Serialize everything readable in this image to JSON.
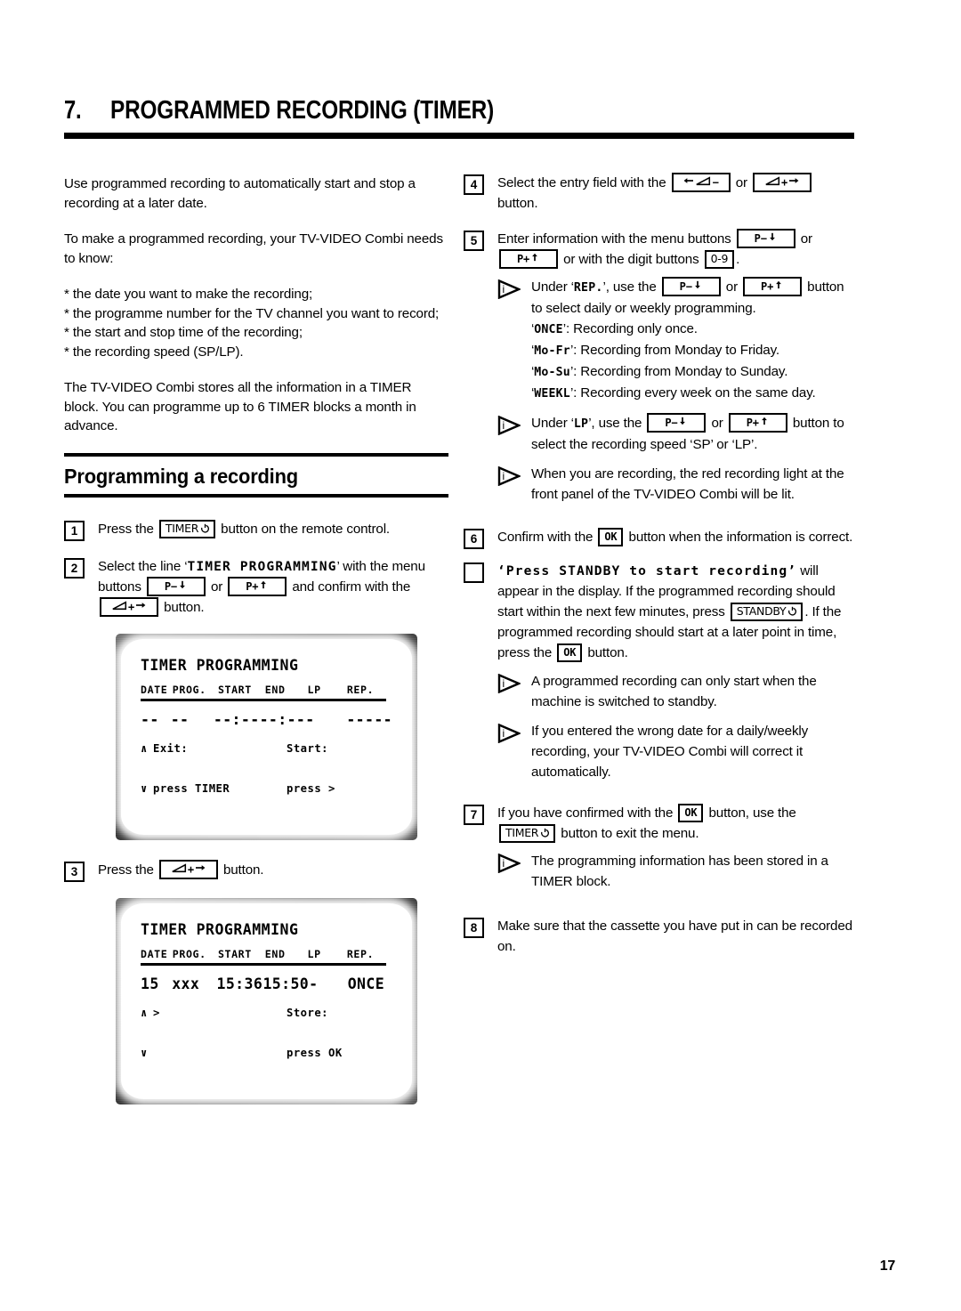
{
  "chapter": {
    "number": "7.",
    "title": "PROGRAMMED RECORDING (TIMER)"
  },
  "page_number": "17",
  "intro": {
    "para1": "Use programmed recording to automatically start and stop a recording at a later date.",
    "para2": "To make a programmed recording, your TV-VIDEO Combi needs to know:",
    "bullets": [
      "* the date you want to make the recording;",
      "* the programme number for the TV channel you want to record;",
      "* the start and stop time of the recording;",
      "* the recording speed (SP/LP)."
    ],
    "para3": "The TV-VIDEO Combi stores all the information in a TIMER block. You can programme up to 6 TIMER blocks a month in advance."
  },
  "section": {
    "heading": "Programming a recording"
  },
  "keys": {
    "timer": "TIMER",
    "standby": "STANDBY",
    "ok": "OK",
    "digits": "0-9",
    "p_minus": "P",
    "p_plus": "P",
    "minus": "−",
    "plus": "+"
  },
  "steps": {
    "s1": {
      "num": "1",
      "t1": "Press the",
      "t2": "button on the remote control."
    },
    "s2": {
      "num": "2",
      "t1": "Select the line ‘",
      "menu_line": "TIMER PROGRAMMING",
      "t2": "’ with the menu buttons",
      "t3": "or",
      "t4": "and confirm with the",
      "t5": "button."
    },
    "s3": {
      "num": "3",
      "t1": "Press the",
      "t2": "button."
    },
    "s4": {
      "num": "4",
      "t1": "Select the entry field with the",
      "t2": "or",
      "t3": "button."
    },
    "s5": {
      "num": "5",
      "t1": "Enter information with the menu buttons",
      "t2": "or",
      "t3": "or with the digit buttons",
      "t4": ".",
      "info1": {
        "t1": "Under ‘",
        "field": "REP.",
        "t2": "’, use the",
        "t3": "or",
        "t4": "button to select daily or weekly programming.",
        "options": [
          {
            "code": "ONCE",
            "desc": "’: Recording only once."
          },
          {
            "code": "Mo-Fr",
            "desc": "’: Recording from Monday to Friday."
          },
          {
            "code": "Mo-Su",
            "desc": "’: Recording from Monday to Sunday."
          },
          {
            "code": "WEEKL",
            "desc": "’: Recording every week on the same day."
          }
        ]
      },
      "info2": {
        "t1": "Under ‘",
        "field": "LP",
        "t2": "’, use the",
        "t3": "or",
        "t4": "button to select the recording speed ‘SP’ or ‘LP’."
      },
      "info3": {
        "text": "When you are recording, the red recording light at the front panel of the TV-VIDEO Combi will be lit."
      }
    },
    "s6": {
      "num": "6",
      "t1": "Confirm with the",
      "t2": "button when the information is correct."
    },
    "s_box": {
      "num": "",
      "display_msg": "‘Press STANDBY to start recording’",
      "t1": "will appear in the display. If the programmed recording should start within the next few minutes, press",
      "t2": ". If the programmed recording should start at a later point in time, press the",
      "t3": "button.",
      "info1": {
        "text": "A programmed recording can only start when the machine is switched to standby."
      },
      "info2": {
        "text": "If you entered the wrong date for a daily/weekly recording, your TV-VIDEO Combi will correct it automatically."
      }
    },
    "s7": {
      "num": "7",
      "t1": "If you have confirmed with the",
      "t2": "button, use the",
      "t3": "button to exit the menu.",
      "info1": {
        "text": "The programming information has been stored in a TIMER block."
      }
    },
    "s8": {
      "num": "8",
      "t1": "Make sure that the cassette you have put in can be recorded on."
    }
  },
  "osd_screen_1": {
    "title": "TIMER PROGRAMMING",
    "columns": [
      "DATE",
      "PROG.",
      "START",
      "END",
      "LP",
      "REP."
    ],
    "row": [
      "--",
      "--",
      "--:--",
      "--:---",
      "",
      "-----"
    ],
    "footer": {
      "up_arrow": "∧",
      "down_arrow": "∨",
      "left_line1": "Exit:",
      "left_line2": "press TIMER",
      "right_line1": "Start:",
      "right_line2": "press >"
    }
  },
  "osd_screen_2": {
    "title": "TIMER PROGRAMMING",
    "columns": [
      "DATE",
      "PROG.",
      "START",
      "END",
      "LP",
      "REP."
    ],
    "row": [
      "15",
      "xxx",
      "15:36",
      "15:50",
      "-",
      "ONCE"
    ],
    "footer": {
      "up_arrow": "∧",
      "down_arrow": "∨",
      "left_line1": ">",
      "left_line2": "",
      "right_line1": "Store:",
      "right_line2": "press OK"
    }
  }
}
